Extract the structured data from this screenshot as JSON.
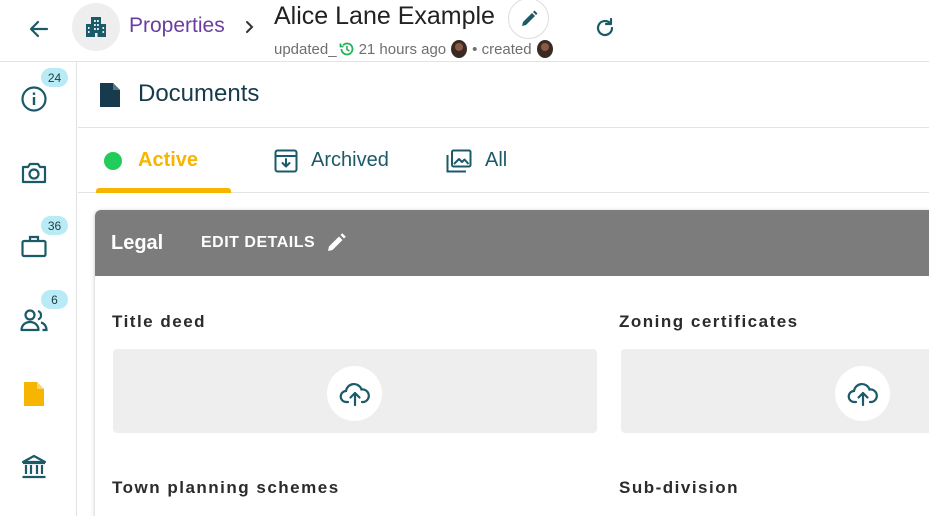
{
  "header": {
    "breadcrumb_label": "Properties",
    "title": "Alice Lane Example",
    "updated_prefix": "updated_",
    "updated_time": "21 hours ago",
    "created_label": "• created"
  },
  "sidebar": {
    "badges": {
      "info": "24",
      "briefcase": "36",
      "people": "6"
    }
  },
  "section": {
    "title": "Documents"
  },
  "tabs": [
    {
      "label": "Active"
    },
    {
      "label": "Archived"
    },
    {
      "label": "All"
    }
  ],
  "card": {
    "title": "Legal",
    "edit_label": "EDIT DETAILS",
    "fields": [
      {
        "label": "Title deed"
      },
      {
        "label": "Zoning certificates"
      },
      {
        "label": "Town planning schemes"
      },
      {
        "label": "Sub-division"
      }
    ]
  },
  "colors": {
    "accent": "#f7b500",
    "link": "#6a3ea1",
    "teal": "#1b5a69",
    "active_dot": "#22cc5a",
    "badge": "#b8ebf5",
    "card_header": "#7c7c7c"
  }
}
